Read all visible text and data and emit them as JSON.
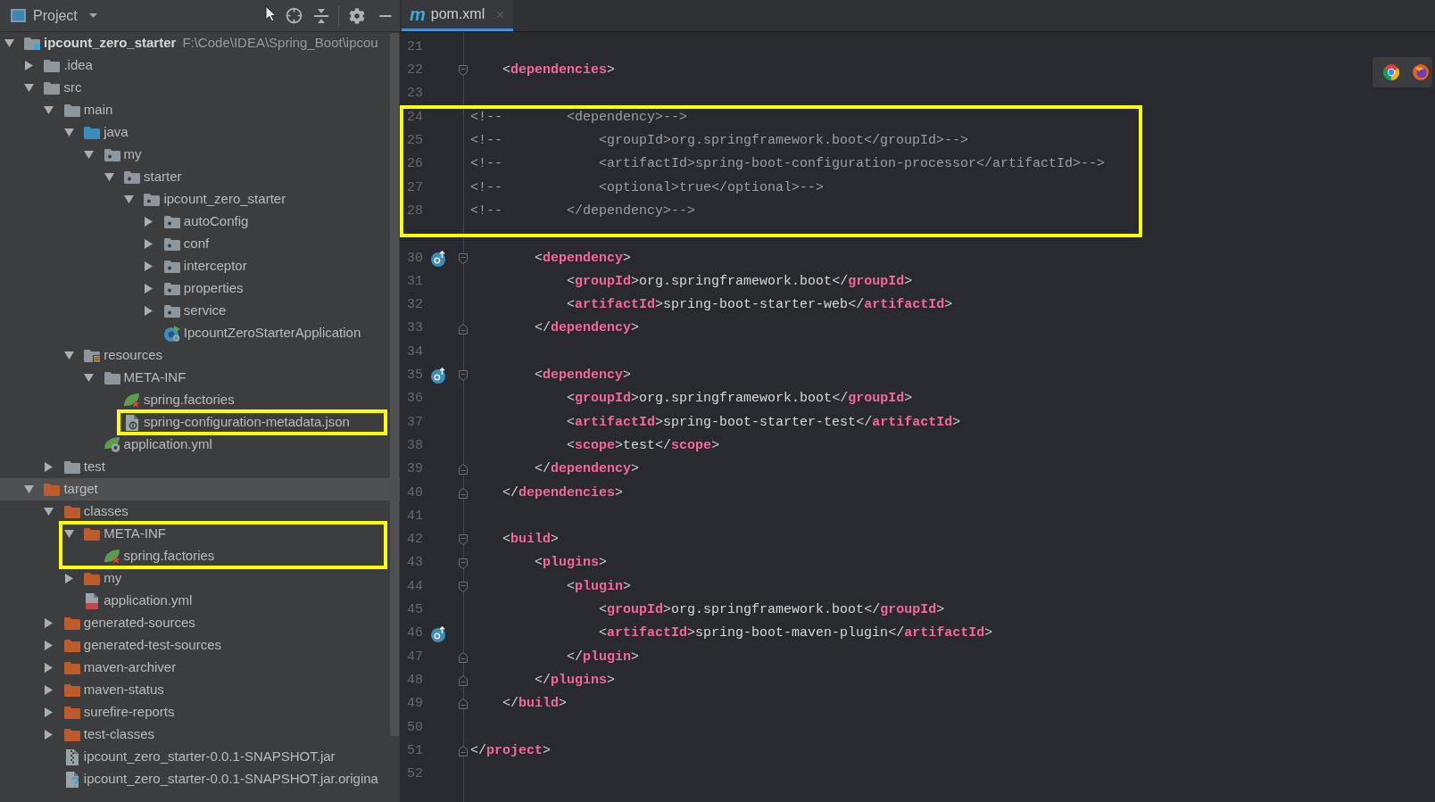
{
  "project_panel": {
    "title": "Project",
    "tree": [
      {
        "label": "ipcount_zero_starter",
        "path": "F:\\Code\\IDEA\\Spring_Boot\\ipcou",
        "kind": "module",
        "expanded": true,
        "selected": false,
        "children": [
          {
            "label": ".idea",
            "kind": "folder",
            "expanded": false,
            "selected": false
          },
          {
            "label": "src",
            "kind": "folder",
            "expanded": true,
            "selected": false,
            "children": [
              {
                "label": "main",
                "kind": "folder",
                "expanded": true,
                "selected": false,
                "children": [
                  {
                    "label": "java",
                    "kind": "source_folder",
                    "expanded": true,
                    "selected": false,
                    "children": [
                      {
                        "label": "my",
                        "kind": "package",
                        "expanded": true,
                        "selected": false,
                        "children": [
                          {
                            "label": "starter",
                            "kind": "package",
                            "expanded": true,
                            "selected": false,
                            "children": [
                              {
                                "label": "ipcount_zero_starter",
                                "kind": "package",
                                "expanded": true,
                                "selected": false,
                                "children": [
                                  {
                                    "label": "autoConfig",
                                    "kind": "package",
                                    "expanded": false,
                                    "selected": false
                                  },
                                  {
                                    "label": "conf",
                                    "kind": "package",
                                    "expanded": false,
                                    "selected": false
                                  },
                                  {
                                    "label": "interceptor",
                                    "kind": "package",
                                    "expanded": false,
                                    "selected": false
                                  },
                                  {
                                    "label": "properties",
                                    "kind": "package",
                                    "expanded": false,
                                    "selected": false
                                  },
                                  {
                                    "label": "service",
                                    "kind": "package",
                                    "expanded": false,
                                    "selected": false
                                  },
                                  {
                                    "label": "IpcountZeroStarterApplication",
                                    "kind": "spring_class",
                                    "selected": false
                                  }
                                ]
                              }
                            ]
                          }
                        ]
                      }
                    ]
                  },
                  {
                    "label": "resources",
                    "kind": "resources_folder",
                    "expanded": true,
                    "selected": false,
                    "children": [
                      {
                        "label": "META-INF",
                        "kind": "folder",
                        "expanded": true,
                        "selected": false,
                        "children": [
                          {
                            "label": "spring.factories",
                            "kind": "spring_factories",
                            "selected": false
                          },
                          {
                            "label": "spring-configuration-metadata.json",
                            "kind": "json_file",
                            "selected": false,
                            "highlighted": true
                          }
                        ]
                      },
                      {
                        "label": "application.yml",
                        "kind": "spring_config",
                        "selected": false
                      }
                    ]
                  }
                ]
              },
              {
                "label": "test",
                "kind": "folder",
                "expanded": false,
                "selected": false
              }
            ]
          },
          {
            "label": "target",
            "kind": "excluded_folder",
            "expanded": true,
            "selected": true,
            "children": [
              {
                "label": "classes",
                "kind": "excluded_folder",
                "expanded": true,
                "selected": false,
                "children": [
                  {
                    "label": "META-INF",
                    "kind": "excluded_folder",
                    "expanded": true,
                    "selected": false,
                    "highlighted": true,
                    "children": [
                      {
                        "label": "spring.factories",
                        "kind": "spring_factories",
                        "selected": false
                      }
                    ]
                  },
                  {
                    "label": "my",
                    "kind": "excluded_folder",
                    "expanded": false,
                    "selected": false
                  },
                  {
                    "label": "application.yml",
                    "kind": "yml_file",
                    "selected": false
                  }
                ]
              },
              {
                "label": "generated-sources",
                "kind": "excluded_folder",
                "expanded": false,
                "selected": false
              },
              {
                "label": "generated-test-sources",
                "kind": "excluded_folder",
                "expanded": false,
                "selected": false
              },
              {
                "label": "maven-archiver",
                "kind": "excluded_folder",
                "expanded": false,
                "selected": false
              },
              {
                "label": "maven-status",
                "kind": "excluded_folder",
                "expanded": false,
                "selected": false
              },
              {
                "label": "surefire-reports",
                "kind": "excluded_folder",
                "expanded": false,
                "selected": false
              },
              {
                "label": "test-classes",
                "kind": "excluded_folder",
                "expanded": false,
                "selected": false
              },
              {
                "label": "ipcount_zero_starter-0.0.1-SNAPSHOT.jar",
                "kind": "jar_file",
                "selected": false
              },
              {
                "label": "ipcount_zero_starter-0.0.1-SNAPSHOT.jar.origina",
                "kind": "unknown_file",
                "selected": false
              }
            ]
          }
        ]
      }
    ]
  },
  "editor": {
    "tabs": [
      {
        "icon_text": "m",
        "label": "pom.xml",
        "selected": true
      }
    ],
    "lines": [
      {
        "number": "21"
      },
      {
        "number": "22",
        "kind": "xml",
        "text": "    <dependencies>",
        "fold": {
          "kind": "start"
        }
      },
      {
        "number": "23"
      },
      {
        "number": "24",
        "kind": "comment",
        "text": "<!--        <dependency>-->",
        "highlighted": true
      },
      {
        "number": "25",
        "kind": "comment",
        "text": "<!--            <groupId>org.springframework.boot</groupId>-->",
        "highlighted": true
      },
      {
        "number": "26",
        "kind": "comment",
        "text": "<!--            <artifactId>spring-boot-configuration-processor</artifactId>-->",
        "highlighted": true
      },
      {
        "number": "27",
        "kind": "comment",
        "text": "<!--            <optional>true</optional>-->",
        "highlighted": true
      },
      {
        "number": "28",
        "kind": "comment",
        "text": "<!--        </dependency>-->",
        "highlighted": true
      },
      {
        "number": "30",
        "kind": "xml",
        "text": "        <dependency>",
        "fold": {
          "kind": "start"
        },
        "marker": true
      },
      {
        "number": "31",
        "kind": "xml",
        "text": "            <groupId>org.springframework.boot</groupId>"
      },
      {
        "number": "32",
        "kind": "xml",
        "text": "            <artifactId>spring-boot-starter-web</artifactId>"
      },
      {
        "number": "33",
        "kind": "xml",
        "text": "        </dependency>",
        "fold": {
          "kind": "end"
        }
      },
      {
        "number": "34"
      },
      {
        "number": "35",
        "kind": "xml",
        "text": "        <dependency>",
        "fold": {
          "kind": "start"
        },
        "marker": true
      },
      {
        "number": "36",
        "kind": "xml",
        "text": "            <groupId>org.springframework.boot</groupId>"
      },
      {
        "number": "37",
        "kind": "xml",
        "text": "            <artifactId>spring-boot-starter-test</artifactId>"
      },
      {
        "number": "38",
        "kind": "xml",
        "text": "            <scope>test</scope>"
      },
      {
        "number": "39",
        "kind": "xml",
        "text": "        </dependency>",
        "fold": {
          "kind": "end"
        }
      },
      {
        "number": "40",
        "kind": "xml",
        "text": "    </dependencies>",
        "fold": {
          "kind": "end"
        }
      },
      {
        "number": "41"
      },
      {
        "number": "42",
        "kind": "xml",
        "text": "    <build>",
        "fold": {
          "kind": "start"
        }
      },
      {
        "number": "43",
        "kind": "xml",
        "text": "        <plugins>",
        "fold": {
          "kind": "start"
        }
      },
      {
        "number": "44",
        "kind": "xml",
        "text": "            <plugin>",
        "fold": {
          "kind": "start"
        }
      },
      {
        "number": "45",
        "kind": "xml",
        "text": "                <groupId>org.springframework.boot</groupId>"
      },
      {
        "number": "46",
        "kind": "xml",
        "text": "                <artifactId>spring-boot-maven-plugin</artifactId>",
        "marker": true
      },
      {
        "number": "47",
        "kind": "xml",
        "text": "            </plugin>",
        "fold": {
          "kind": "end"
        }
      },
      {
        "number": "48",
        "kind": "xml",
        "text": "        </plugins>",
        "fold": {
          "kind": "end"
        }
      },
      {
        "number": "49",
        "kind": "xml",
        "text": "    </build>",
        "fold": {
          "kind": "end"
        }
      },
      {
        "number": "50"
      },
      {
        "number": "51",
        "kind": "xml",
        "text": "</project>",
        "fold": {
          "kind": "end"
        }
      },
      {
        "number": "52"
      }
    ]
  }
}
